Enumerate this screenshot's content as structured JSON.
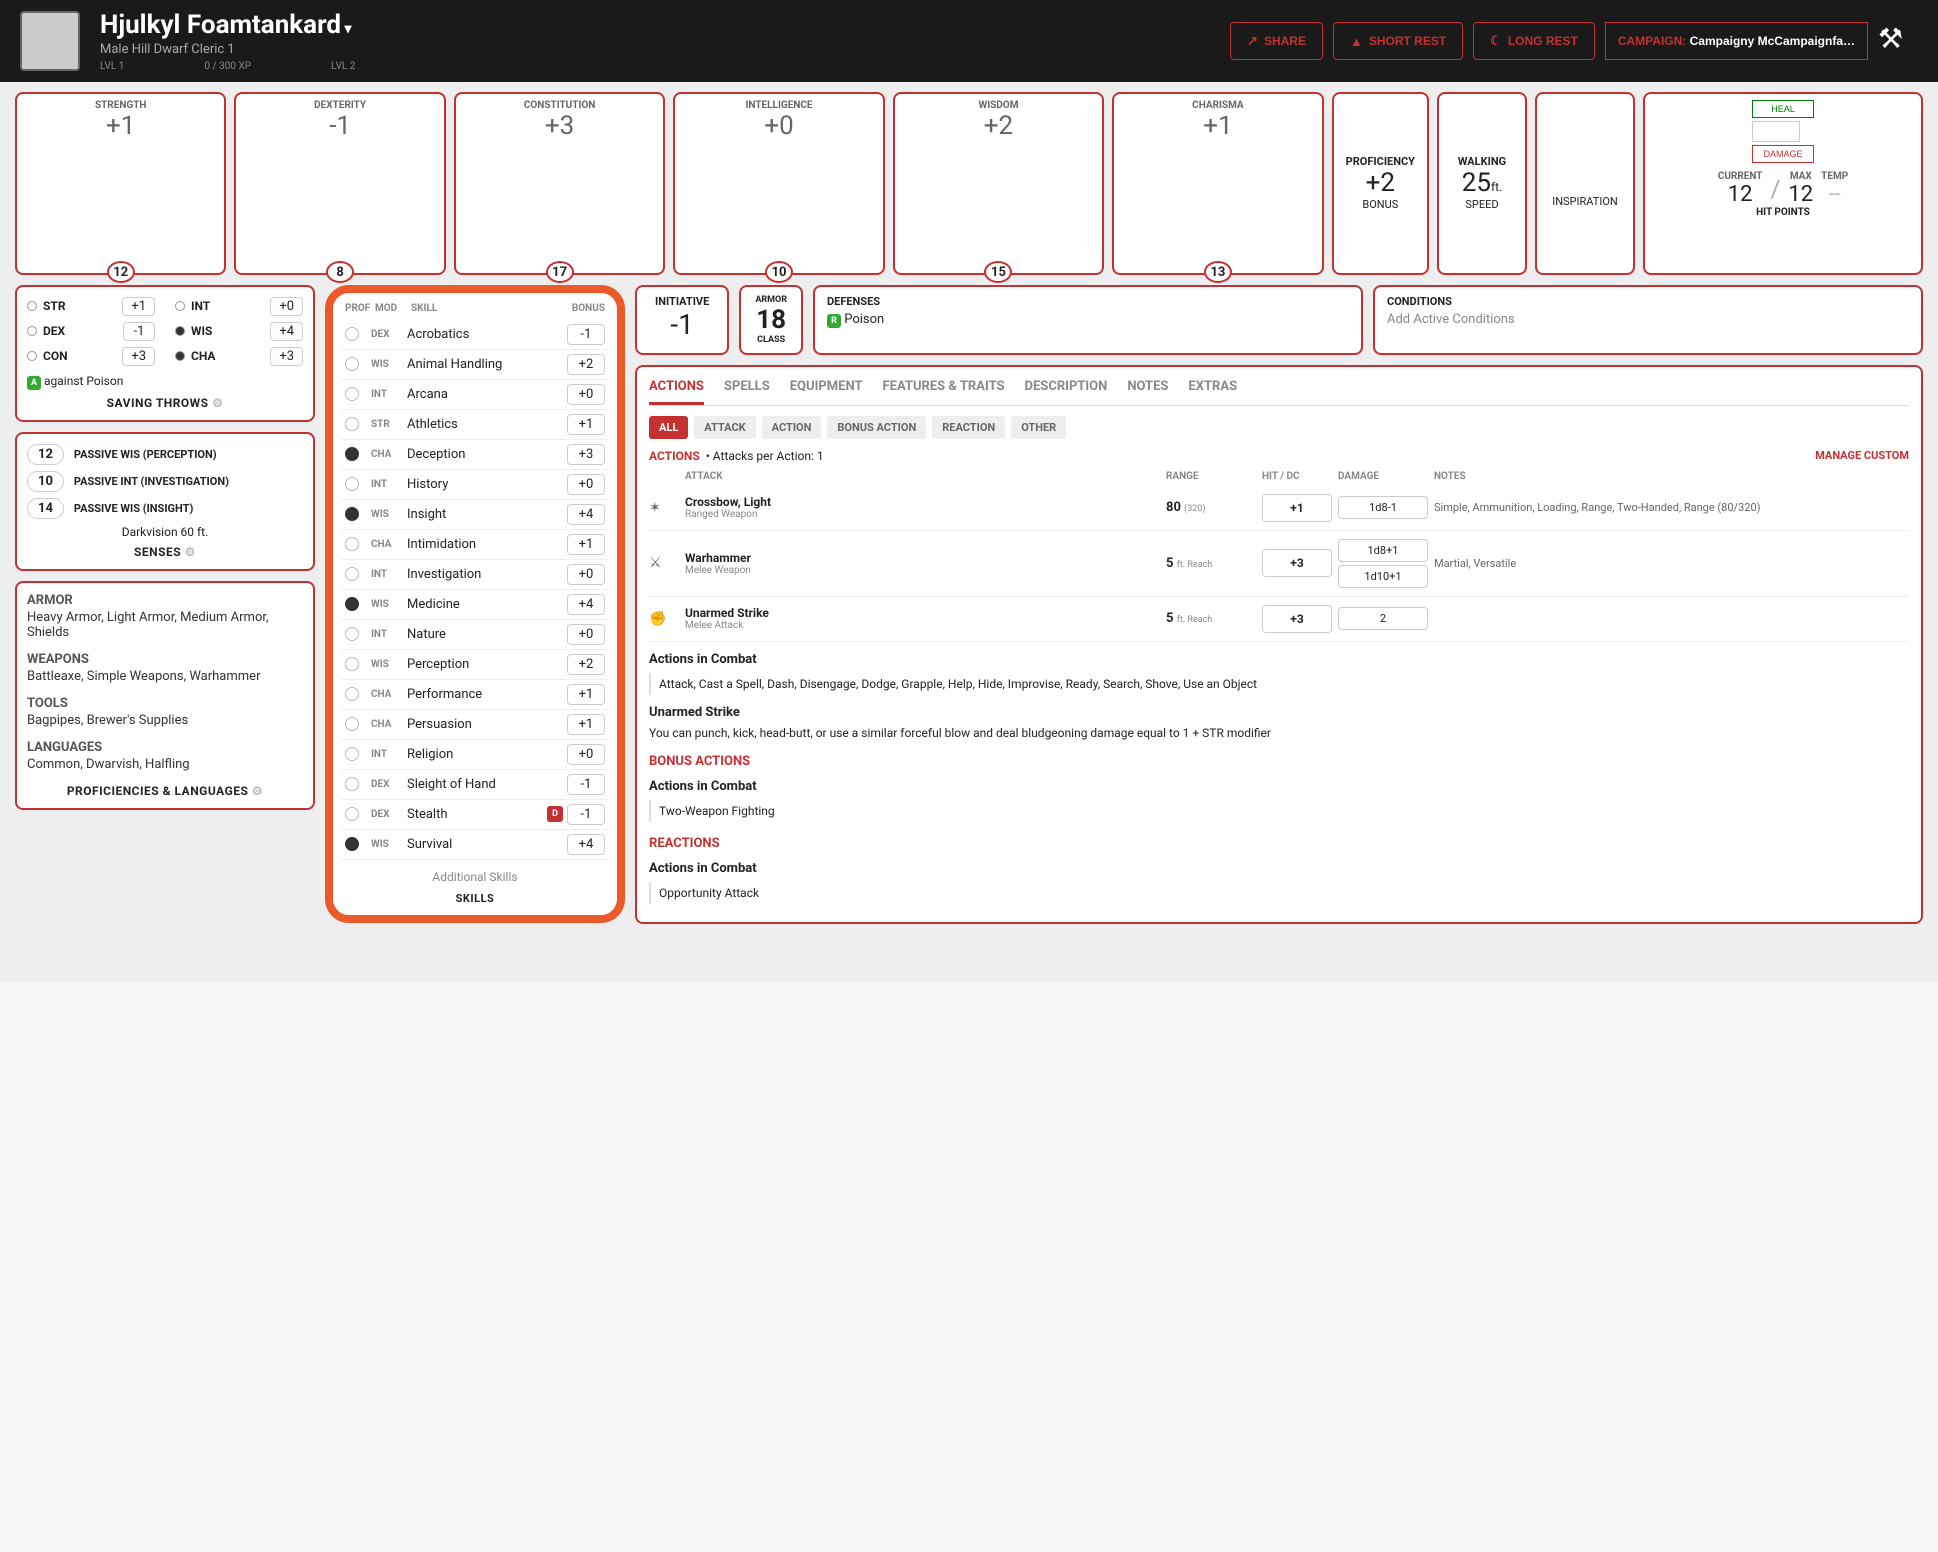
{
  "header": {
    "name": "Hjulkyl Foamtankard",
    "sub": "Male Hill Dwarf Cleric 1",
    "lvl1": "LVL 1",
    "lvl2": "LVL 2",
    "xp": "0 / 300 XP",
    "share": "SHARE",
    "short_rest": "SHORT REST",
    "long_rest": "LONG REST",
    "campaign_lbl": "CAMPAIGN:",
    "campaign": "Campaigny McCampaignfa…"
  },
  "abilities": [
    {
      "n": "STRENGTH",
      "m": "+1",
      "s": "12"
    },
    {
      "n": "DEXTERITY",
      "m": "-1",
      "s": "8"
    },
    {
      "n": "CONSTITUTION",
      "m": "+3",
      "s": "17"
    },
    {
      "n": "INTELLIGENCE",
      "m": "+0",
      "s": "10"
    },
    {
      "n": "WISDOM",
      "m": "+2",
      "s": "15"
    },
    {
      "n": "CHARISMA",
      "m": "+1",
      "s": "13"
    }
  ],
  "prof": {
    "t": "PROFICIENCY",
    "v": "+2",
    "s": "BONUS"
  },
  "speed": {
    "t": "WALKING",
    "v": "25",
    "u": "ft.",
    "s": "SPEED"
  },
  "insp": {
    "t": "INSPIRATION"
  },
  "hp": {
    "heal": "HEAL",
    "dmg": "DAMAGE",
    "cur_l": "CURRENT",
    "cur": "12",
    "max_l": "MAX",
    "max": "12",
    "temp_l": "TEMP",
    "temp": "--",
    "title": "HIT POINTS"
  },
  "init": {
    "t": "INITIATIVE",
    "v": "-1"
  },
  "ac": {
    "t": "ARMOR",
    "v": "18",
    "s": "CLASS"
  },
  "defenses": {
    "t": "DEFENSES",
    "v": "Poison"
  },
  "conditions": {
    "t": "CONDITIONS",
    "v": "Add Active Conditions"
  },
  "saves": {
    "rows": [
      {
        "p": false,
        "n": "STR",
        "v": "+1"
      },
      {
        "p": false,
        "n": "INT",
        "v": "+0"
      },
      {
        "p": false,
        "n": "DEX",
        "v": "-1"
      },
      {
        "p": true,
        "n": "WIS",
        "v": "+4"
      },
      {
        "p": false,
        "n": "CON",
        "v": "+3"
      },
      {
        "p": true,
        "n": "CHA",
        "v": "+3"
      }
    ],
    "note_pill": "A",
    "note": "against Poison",
    "title": "SAVING THROWS"
  },
  "senses": {
    "rows": [
      {
        "v": "12",
        "l": "PASSIVE WIS (PERCEPTION)"
      },
      {
        "v": "10",
        "l": "PASSIVE INT (INVESTIGATION)"
      },
      {
        "v": "14",
        "l": "PASSIVE WIS (INSIGHT)"
      }
    ],
    "extra": "Darkvision 60 ft.",
    "title": "SENSES"
  },
  "profs": {
    "armor_h": "ARMOR",
    "armor": "Heavy Armor, Light Armor, Medium Armor, Shields",
    "weapons_h": "WEAPONS",
    "weapons": "Battleaxe, Simple Weapons, Warhammer",
    "tools_h": "TOOLS",
    "tools": "Bagpipes, Brewer's Supplies",
    "lang_h": "LANGUAGES",
    "lang": "Common, Dwarvish, Halfling",
    "title": "PROFICIENCIES & LANGUAGES"
  },
  "skills_hdr": {
    "p": "PROF",
    "m": "MOD",
    "s": "SKILL",
    "b": "BONUS"
  },
  "skills": [
    {
      "p": false,
      "a": "DEX",
      "n": "Acrobatics",
      "b": "-1",
      "d": false
    },
    {
      "p": false,
      "a": "WIS",
      "n": "Animal Handling",
      "b": "+2",
      "d": false
    },
    {
      "p": false,
      "a": "INT",
      "n": "Arcana",
      "b": "+0",
      "d": false
    },
    {
      "p": false,
      "a": "STR",
      "n": "Athletics",
      "b": "+1",
      "d": false
    },
    {
      "p": true,
      "a": "CHA",
      "n": "Deception",
      "b": "+3",
      "d": false
    },
    {
      "p": false,
      "a": "INT",
      "n": "History",
      "b": "+0",
      "d": false
    },
    {
      "p": true,
      "a": "WIS",
      "n": "Insight",
      "b": "+4",
      "d": false
    },
    {
      "p": false,
      "a": "CHA",
      "n": "Intimidation",
      "b": "+1",
      "d": false
    },
    {
      "p": false,
      "a": "INT",
      "n": "Investigation",
      "b": "+0",
      "d": false
    },
    {
      "p": true,
      "a": "WIS",
      "n": "Medicine",
      "b": "+4",
      "d": false
    },
    {
      "p": false,
      "a": "INT",
      "n": "Nature",
      "b": "+0",
      "d": false
    },
    {
      "p": false,
      "a": "WIS",
      "n": "Perception",
      "b": "+2",
      "d": false
    },
    {
      "p": false,
      "a": "CHA",
      "n": "Performance",
      "b": "+1",
      "d": false
    },
    {
      "p": false,
      "a": "CHA",
      "n": "Persuasion",
      "b": "+1",
      "d": false
    },
    {
      "p": false,
      "a": "INT",
      "n": "Religion",
      "b": "+0",
      "d": false
    },
    {
      "p": false,
      "a": "DEX",
      "n": "Sleight of Hand",
      "b": "-1",
      "d": false
    },
    {
      "p": false,
      "a": "DEX",
      "n": "Stealth",
      "b": "-1",
      "d": true
    },
    {
      "p": true,
      "a": "WIS",
      "n": "Survival",
      "b": "+4",
      "d": false
    }
  ],
  "skills_add": "Additional Skills",
  "skills_title": "SKILLS",
  "tabs": [
    "ACTIONS",
    "SPELLS",
    "EQUIPMENT",
    "FEATURES & TRAITS",
    "DESCRIPTION",
    "NOTES",
    "EXTRAS"
  ],
  "filters": [
    "ALL",
    "ATTACK",
    "ACTION",
    "BONUS ACTION",
    "REACTION",
    "OTHER"
  ],
  "actions_hdr": {
    "h": "ACTIONS",
    "sub": "• Attacks per Action: 1",
    "mg": "MANAGE CUSTOM"
  },
  "atk_cols": {
    "a": "ATTACK",
    "r": "RANGE",
    "h": "HIT / DC",
    "d": "DAMAGE",
    "n": "NOTES"
  },
  "attacks": [
    {
      "ic": "✶",
      "n": "Crossbow, Light",
      "sub": "Ranged Weapon",
      "r": "80",
      "ru": "(320)",
      "h": "+1",
      "d": [
        "1d8-1"
      ],
      "notes": "Simple, Ammunition, Loading, Range, Two-Handed, Range (80/320)"
    },
    {
      "ic": "⚔",
      "n": "Warhammer",
      "sub": "Melee Weapon",
      "r": "5",
      "ru": "ft.\nReach",
      "h": "+3",
      "d": [
        "1d8+1",
        "1d10+1"
      ],
      "notes": "Martial, Versatile"
    },
    {
      "ic": "✊",
      "n": "Unarmed Strike",
      "sub": "Melee Attack",
      "r": "5",
      "ru": "ft.\nReach",
      "h": "+3",
      "d": [
        "2"
      ],
      "notes": ""
    }
  ],
  "aic_h": "Actions in Combat",
  "aic": "Attack, Cast a Spell, Dash, Disengage, Dodge, Grapple, Help, Hide, Improvise, Ready, Search, Shove, Use an Object",
  "us_h": "Unarmed Strike",
  "us": "You can punch, kick, head-butt, or use a similar forceful blow and deal bludgeoning damage equal to 1 + STR modifier",
  "ba_h": "BONUS ACTIONS",
  "ba_sub": "Actions in Combat",
  "ba": "Two-Weapon Fighting",
  "re_h": "REACTIONS",
  "re_sub": "Actions in Combat",
  "re": "Opportunity Attack"
}
